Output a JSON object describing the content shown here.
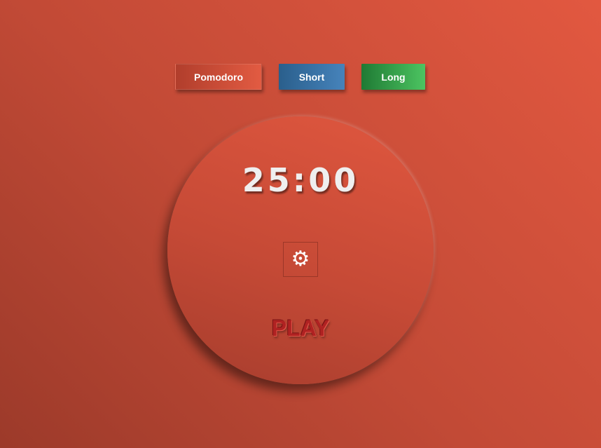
{
  "modes": {
    "pomodoro_label": "Pomodoro",
    "short_label": "Short",
    "long_label": "Long"
  },
  "timer": {
    "display": "25:00",
    "play_label": "PLAY"
  },
  "icons": {
    "settings": "gear-icon"
  },
  "colors": {
    "background": "#c24a36",
    "pomodoro": "#e25b42",
    "short": "#4683bb",
    "long": "#4cc461",
    "play_text": "#b02222"
  }
}
